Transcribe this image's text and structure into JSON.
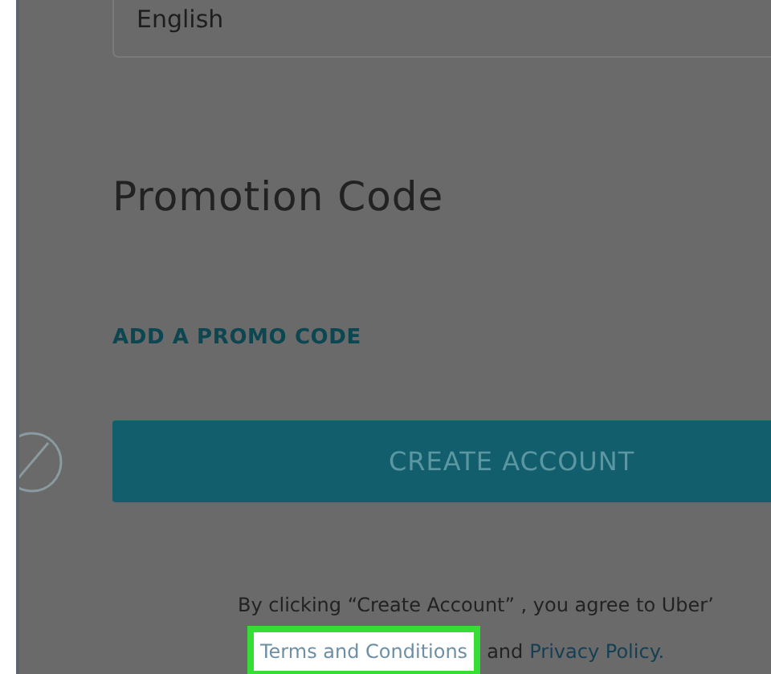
{
  "language_select": {
    "value": "English"
  },
  "promotion": {
    "title": "Promotion Code",
    "link": "ADD A PROMO CODE"
  },
  "create_button": {
    "label": "CREATE ACCOUNT"
  },
  "terms": {
    "prefix": "By clicking “Create Account” , you agree to Uber’",
    "terms_link": {
      "label": "Terms and Conditions",
      "highlighted": true
    },
    "middle": "and",
    "privacy_link": {
      "label": "Privacy Policy."
    }
  }
}
